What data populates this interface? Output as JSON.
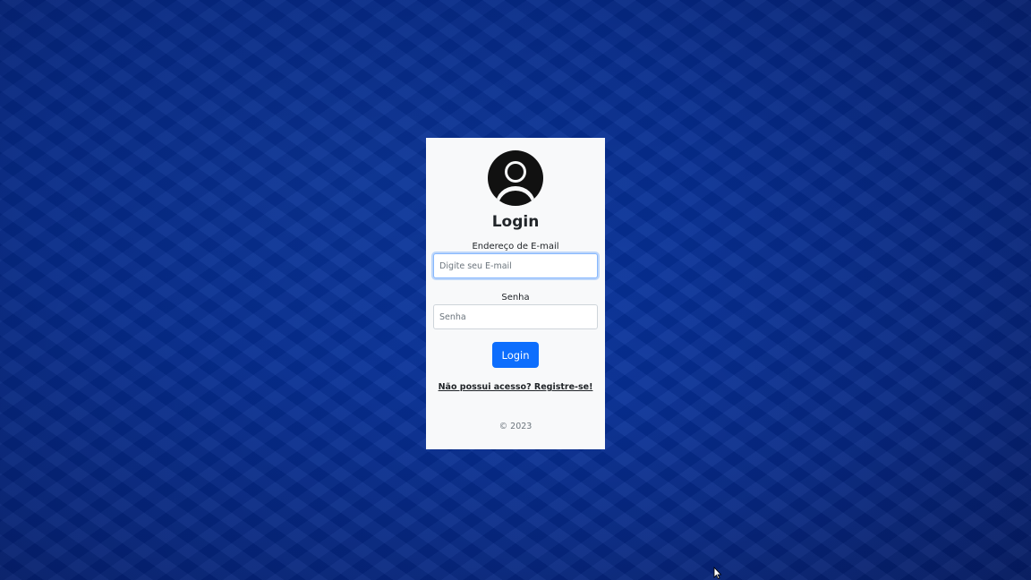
{
  "colors": {
    "background": "#0633a0",
    "card": "#f8f9fa",
    "primary": "#0d6efd",
    "text": "#212529"
  },
  "form": {
    "avatar_icon": "user-circle-icon",
    "title": "Login",
    "email": {
      "label": "Endereço de E-mail",
      "placeholder": "Digite seu E-mail",
      "value": ""
    },
    "password": {
      "label": "Senha",
      "placeholder": "Senha",
      "value": ""
    },
    "submit_label": "Login",
    "register_link": "Não possui acesso? Registre-se!",
    "footer": "© 2023"
  }
}
